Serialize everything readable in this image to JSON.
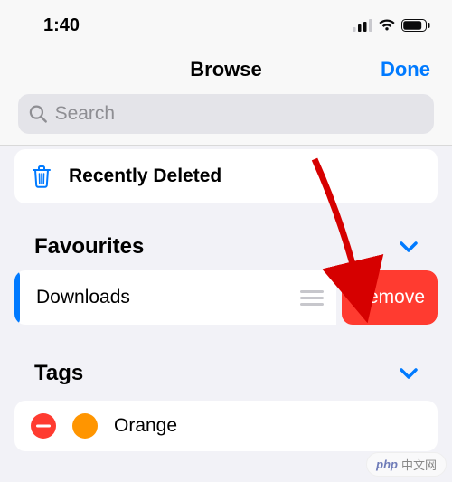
{
  "status": {
    "time": "1:40"
  },
  "header": {
    "title": "Browse",
    "done": "Done"
  },
  "search": {
    "placeholder": "Search"
  },
  "recently_deleted": {
    "label": "Recently Deleted"
  },
  "favourites": {
    "title": "Favourites",
    "item_label": "Downloads",
    "remove_label": "Remove"
  },
  "tags": {
    "title": "Tags",
    "item_label": "Orange",
    "item_color": "#ff9500"
  },
  "watermark": {
    "brand": "php",
    "text": "中文网"
  }
}
